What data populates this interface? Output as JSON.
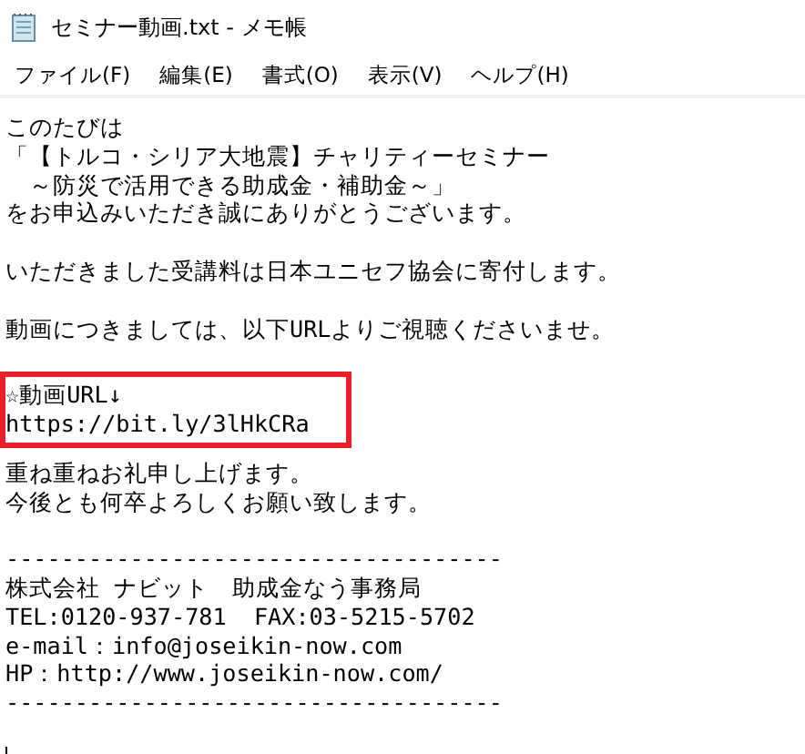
{
  "window": {
    "title": "セミナー動画.txt - メモ帳"
  },
  "menu": [
    "ファイル(F)",
    "編集(E)",
    "書式(O)",
    "表示(V)",
    "ヘルプ(H)"
  ],
  "document": {
    "blocks": [
      {
        "kind": "plain",
        "lines": [
          "このたびは",
          "「【トルコ・シリア大地震】チャリティーセミナー",
          "　～防災で活用できる助成金・補助金～」",
          "をお申込みいただき誠にありがとうございます。"
        ]
      },
      {
        "kind": "plain",
        "lines": [
          "いただきました受講料は日本ユニセフ協会に寄付します。"
        ]
      },
      {
        "kind": "plain",
        "lines": [
          "動画につきましては、以下URLよりご視聴くださいませ。"
        ]
      },
      {
        "kind": "boxed",
        "lines": [
          "☆動画URL↓",
          "https://bit.ly/3lHkCRa"
        ]
      },
      {
        "kind": "tight",
        "lines": [
          "重ね重ねお礼申し上げます。",
          "今後とも何卒よろしくお願い致します。"
        ]
      },
      {
        "kind": "plain",
        "lines": [
          "------------------------------------",
          "株式会社 ナビット　助成金なう事務局",
          "TEL:0120-937-781  FAX:03-5215-5702",
          "e-mail：info@joseikin-now.com",
          "HP：http://www.joseikin-now.com/",
          "------------------------------------"
        ]
      }
    ]
  }
}
